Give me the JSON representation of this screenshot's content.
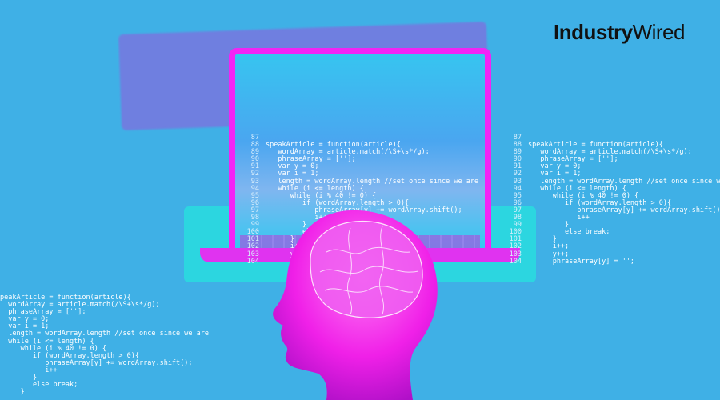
{
  "brand": {
    "name_part1": "Industry",
    "name_part2": "Wired"
  },
  "colors": {
    "background": "#3fb0e6",
    "magenta": "#f224f5",
    "cyan": "#2cd6e0",
    "purple": "#6f7fe0"
  },
  "code_block": {
    "line_numbers": [
      "87",
      "88",
      "89",
      "90",
      "91",
      "92",
      "93",
      "94",
      "95",
      "96",
      "97",
      "98",
      "99",
      "100",
      "101",
      "102",
      "103",
      "104"
    ],
    "lines": [
      "",
      "speakArticle = function(article){",
      "   wordArray = article.match(/\\S+\\s*/g);",
      "   phraseArray = [''];",
      "   var y = 0;",
      "   var i = 1;",
      "   length = wordArray.length //set once since we are",
      "   while (i <= length) {",
      "      while (i % 40 != 0) {",
      "         if (wordArray.length > 0){",
      "            phraseArray[y] += wordArray.shift();",
      "            i++",
      "         }",
      "         else break;",
      "      }",
      "      i++;",
      "      y++;",
      "      phraseArray[y] = '';"
    ],
    "left_lines": [
      "peakArticle = function(article){",
      "  wordArray = article.match(/\\S+\\s*/g);",
      "  phraseArray = [''];",
      "  var y = 0;",
      "  var i = 1;",
      "  length = wordArray.length //set once since we are",
      "  while (i <= length) {",
      "     while (i % 40 != 0) {",
      "        if (wordArray.length > 0){",
      "           phraseArray[y] += wordArray.shift();",
      "           i++",
      "        }",
      "        else break;",
      "     }"
    ]
  }
}
